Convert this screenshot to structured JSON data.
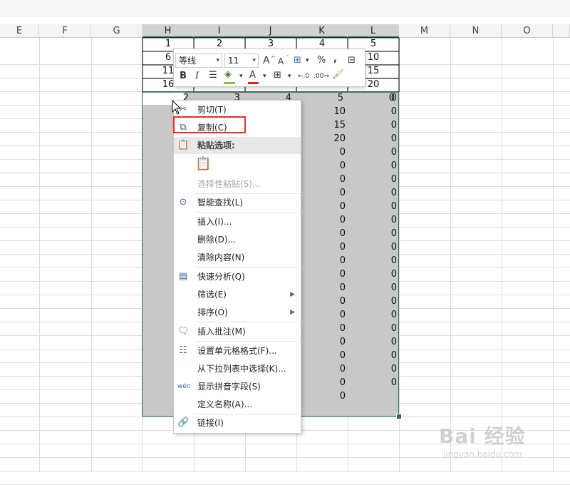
{
  "columns": [
    "E",
    "F",
    "G",
    "H",
    "I",
    "J",
    "K",
    "L",
    "M",
    "N",
    "O"
  ],
  "top_table": {
    "rows": [
      [
        "1",
        "2",
        "3",
        "4",
        "5"
      ],
      [
        "6",
        "",
        "",
        "",
        "10"
      ],
      [
        "11",
        "",
        "",
        "",
        "15"
      ],
      [
        "16",
        "",
        "",
        "",
        "20"
      ]
    ]
  },
  "row_after_table": [
    "2",
    "3",
    "4",
    "5",
    "0"
  ],
  "column_k_values": [
    "10",
    "15",
    "20",
    "0",
    "0",
    "0",
    "0",
    "0",
    "0",
    "0",
    "0",
    "0",
    "0",
    "0",
    "0",
    "0",
    "0",
    "0",
    "0",
    "0",
    "0",
    "0"
  ],
  "column_l_values": [
    "0",
    "0",
    "0",
    "0",
    "0",
    "0",
    "0",
    "0",
    "0",
    "0",
    "0",
    "0",
    "0",
    "0",
    "0",
    "0",
    "0",
    "0",
    "0",
    "0",
    "0",
    "0"
  ],
  "mini_toolbar": {
    "font_name": "等线",
    "font_size": "11",
    "bold": "B",
    "italic": "I",
    "increase_font": "A",
    "decrease_font": "A",
    "percent": "%",
    "comma": ","
  },
  "context_menu": {
    "items": [
      {
        "label": "剪切(T)",
        "icon": "scissors-icon"
      },
      {
        "label": "复制(C)",
        "icon": "copy-icon"
      },
      {
        "label": "粘贴选项:",
        "icon": "paste-icon"
      },
      {
        "label": "选择性粘贴(S)...",
        "icon": ""
      },
      {
        "label": "智能查找(L)",
        "icon": "smart-lookup-icon"
      },
      {
        "label": "插入(I)...",
        "icon": ""
      },
      {
        "label": "删除(D)...",
        "icon": ""
      },
      {
        "label": "清除内容(N)",
        "icon": ""
      },
      {
        "label": "快速分析(Q)",
        "icon": "quick-analysis-icon"
      },
      {
        "label": "筛选(E)",
        "icon": ""
      },
      {
        "label": "排序(O)",
        "icon": ""
      },
      {
        "label": "插入批注(M)",
        "icon": "comment-icon"
      },
      {
        "label": "设置单元格格式(F)...",
        "icon": "format-cells-icon"
      },
      {
        "label": "从下拉列表中选择(K)...",
        "icon": ""
      },
      {
        "label": "显示拼音字段(S)",
        "icon": "phonetic-icon"
      },
      {
        "label": "定义名称(A)...",
        "icon": ""
      },
      {
        "label": "链接(I)",
        "icon": "link-icon"
      }
    ]
  },
  "watermark": {
    "brand": "Bai 经验",
    "url": "jingyan.baidu.com"
  },
  "colors": {
    "selection": "#217346",
    "highlight": "#e03030"
  }
}
